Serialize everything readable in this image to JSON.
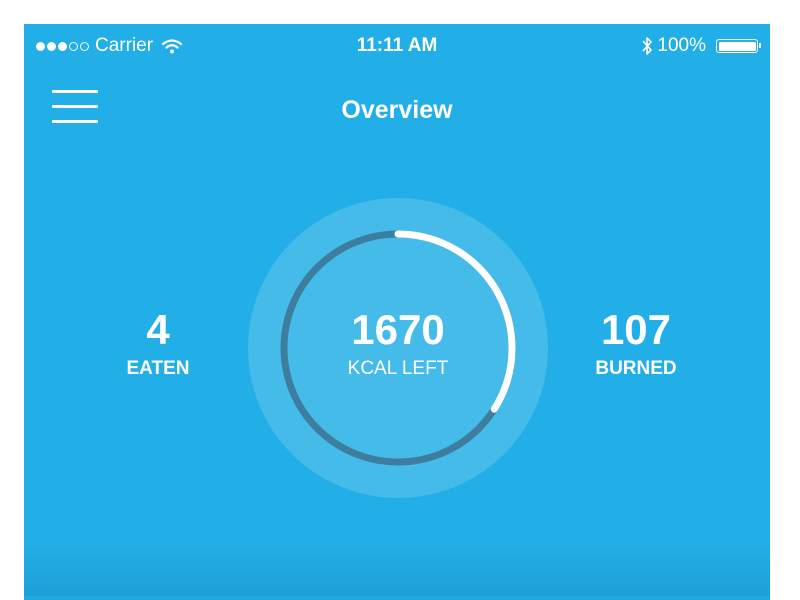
{
  "status_bar": {
    "carrier": "Carrier",
    "time": "11:11 AM",
    "battery": "100%",
    "signal_bars_filled": 3,
    "signal_bars_total": 5
  },
  "nav": {
    "title": "Overview",
    "menu_icon": "hamburger-menu-icon"
  },
  "summary": {
    "eaten_value": "4",
    "eaten_label": "EATEN",
    "center_value": "1670",
    "center_label": "KCAL LEFT",
    "burned_value": "107",
    "burned_label": "BURNED",
    "progress_fraction": 0.34
  },
  "colors": {
    "background": "#22aee6",
    "ring_track": "#3d7e9f",
    "ring_progress": "#ffffff"
  }
}
